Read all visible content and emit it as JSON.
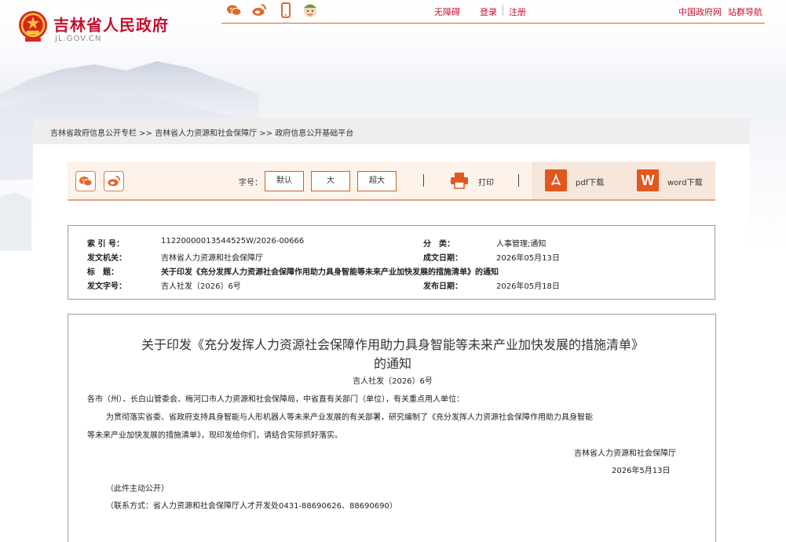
{
  "site": {
    "title": "吉林省人民政府",
    "domain": "JL.GOV.CN"
  },
  "topbar": {
    "icons": [
      "wechat-icon",
      "weibo-icon",
      "mobile-icon",
      "assistant-avatar-icon"
    ],
    "accessibility": "无障碍",
    "login": "登录",
    "register": "注册",
    "gov_link": "中国政府网",
    "sitemap": "站群导航"
  },
  "breadcrumb": "吉林省政府信息公开专栏 >> 吉林省人力资源和社会保障厅 >> 政府信息公开基础平台",
  "toolbar": {
    "font_label": "字号：",
    "font_default": "默认",
    "font_large": "大",
    "font_xlarge": "超大",
    "print": "打印",
    "pdf": "pdf下载",
    "word": "word下载"
  },
  "meta": {
    "index_label": "索 引 号：",
    "index_value": "11220000013544525W/2026-00666",
    "category_label": "分　类：",
    "category_value": "人事管理;通知",
    "issuer_label": "发文机关：",
    "issuer_value": "吉林省人力资源和社会保障厅",
    "created_label": "成文日期：",
    "created_value": "2026年05月13日",
    "title_label": "标　题：",
    "title_value": "关于印发《充分发挥人力资源社会保障作用助力具身智能等未来产业加快发展的措施清单》的通知",
    "docno_label": "发文字号：",
    "docno_value": "吉人社发〔2026〕6号",
    "published_label": "发布日期：",
    "published_value": "2026年05月18日"
  },
  "doc": {
    "title_line1": "关于印发《充分发挥人力资源社会保障作用助力具身智能等未来产业加快发展的措施清单》",
    "title_line2": "的通知",
    "doc_number": "吉人社发〔2026〕6号",
    "addressee": "各市（州）、长白山管委会、梅河口市人力资源和社会保障局，中省直有关部门（单位），有关重点用人单位：",
    "body_line1": "为贯彻落实省委、省政府支持具身智能与人形机器人等未来产业发展的有关部署，研究编制了《充分发挥人力资源社会保障作用助力具身智能",
    "body_line2": "等未来产业加快发展的措施清单》，现印发给你们，请结合实际抓好落实。",
    "signature_org": "吉林省人力资源和社会保障厅",
    "signature_date": "2026年5月13日",
    "disclosure": "（此件主动公开）",
    "contact": "（联系方式：省人力资源和社会保障厅人才开发处0431-88690626、88690690）"
  }
}
